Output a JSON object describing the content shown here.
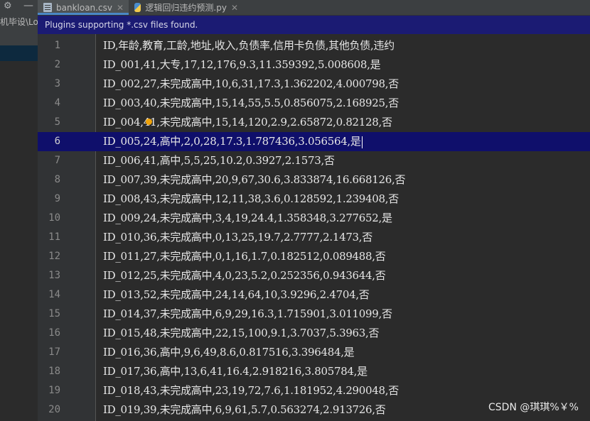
{
  "left_panel": {
    "path_text": "机毕设\\Lo",
    "toolbar_icons": [
      "gear-icon",
      "minus-icon"
    ]
  },
  "tabs": [
    {
      "label": "bankloan.csv",
      "icon": "csv-file-icon",
      "active": true
    },
    {
      "label": "逻辑回归违约预测.py",
      "icon": "python-file-icon",
      "active": false
    }
  ],
  "banner": {
    "text": "Plugins supporting *.csv files found."
  },
  "editor": {
    "current_line": 6,
    "lines": [
      {
        "no": "1",
        "text": "ID,年龄,教育,工龄,地址,收入,负债率,信用卡负债,其他负债,违约"
      },
      {
        "no": "2",
        "text": "ID_001,41,大专,17,12,176,9.3,11.359392,5.008608,是"
      },
      {
        "no": "3",
        "text": "ID_002,27,未完成高中,10,6,31,17.3,1.362202,4.000798,否"
      },
      {
        "no": "4",
        "text": "ID_003,40,未完成高中,15,14,55,5.5,0.856075,2.168925,否"
      },
      {
        "no": "5",
        "text": "ID_004,41,未完成高中,15,14,120,2.9,2.65872,0.82128,否"
      },
      {
        "no": "6",
        "text": "ID_005,24,高中,2,0,28,17.3,1.787436,3.056564,是"
      },
      {
        "no": "7",
        "text": "ID_006,41,高中,5,5,25,10.2,0.3927,2.1573,否"
      },
      {
        "no": "8",
        "text": "ID_007,39,未完成高中,20,9,67,30.6,3.833874,16.668126,否"
      },
      {
        "no": "9",
        "text": "ID_008,43,未完成高中,12,11,38,3.6,0.128592,1.239408,否"
      },
      {
        "no": "10",
        "text": "ID_009,24,未完成高中,3,4,19,24.4,1.358348,3.277652,是"
      },
      {
        "no": "11",
        "text": "ID_010,36,未完成高中,0,13,25,19.7,2.7777,2.1473,否"
      },
      {
        "no": "12",
        "text": "ID_011,27,未完成高中,0,1,16,1.7,0.182512,0.089488,否"
      },
      {
        "no": "13",
        "text": "ID_012,25,未完成高中,4,0,23,5.2,0.252356,0.943644,否"
      },
      {
        "no": "14",
        "text": "ID_013,52,未完成高中,24,14,64,10,3.9296,2.4704,否"
      },
      {
        "no": "15",
        "text": "ID_014,37,未完成高中,6,9,29,16.3,1.715901,3.011099,否"
      },
      {
        "no": "16",
        "text": "ID_015,48,未完成高中,22,15,100,9.1,3.7037,5.3963,否"
      },
      {
        "no": "17",
        "text": "ID_016,36,高中,9,6,49,8.6,0.817516,3.396484,是"
      },
      {
        "no": "18",
        "text": "ID_017,36,高中,13,6,41,16.4,2.918216,3.805784,是"
      },
      {
        "no": "19",
        "text": "ID_018,43,未完成高中,23,19,72,7.6,1.181952,4.290048,否"
      },
      {
        "no": "20",
        "text": "ID_019,39,未完成高中,6,9,61,5.7,0.563274,2.913726,否"
      }
    ]
  },
  "watermark": {
    "text": "CSDN @琪琪%￥%"
  },
  "colors": {
    "banner_bg": "#1b1b73",
    "current_line_bg": "#0f0f6b",
    "editor_bg": "#2b2b2b",
    "accent": "#4a88c7"
  }
}
